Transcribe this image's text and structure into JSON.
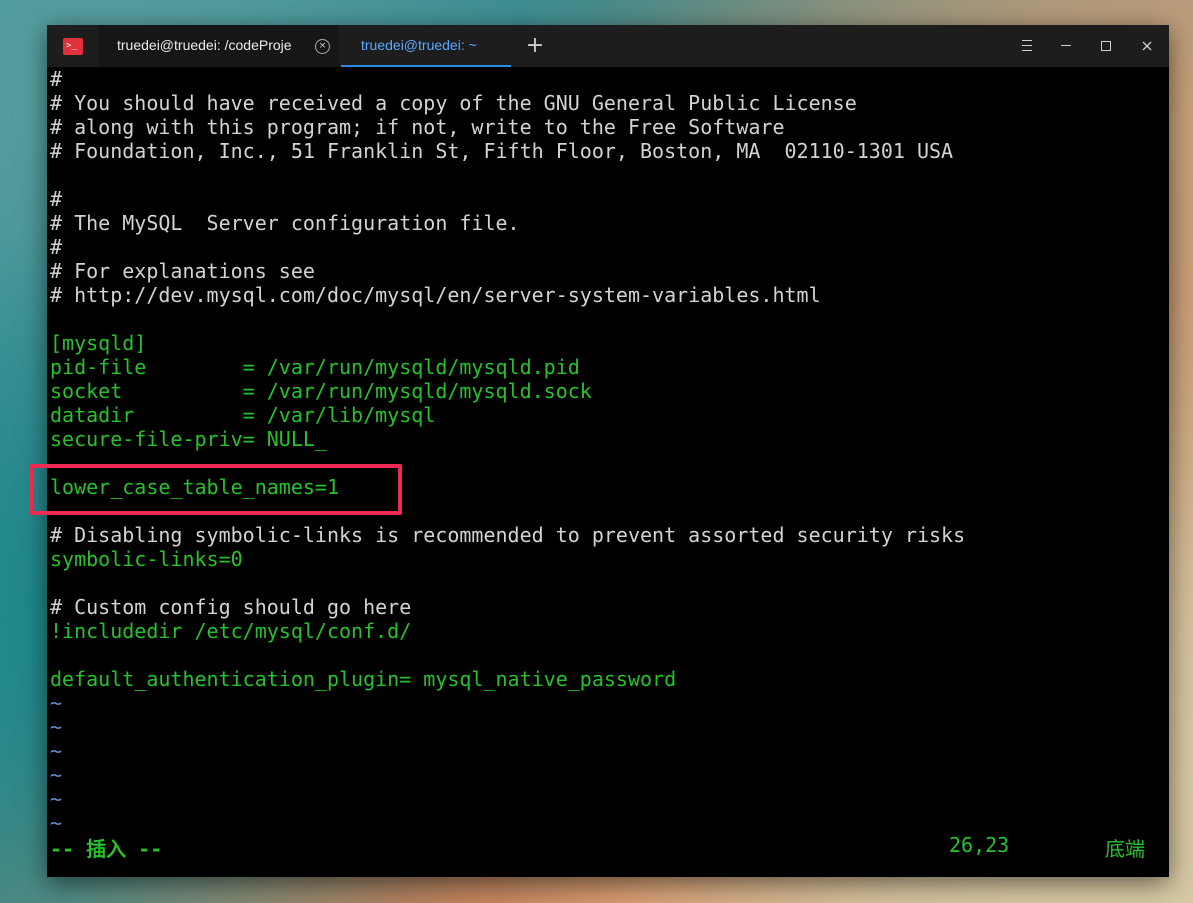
{
  "tabs": [
    {
      "label": "truedei@truedei: /codeProje",
      "close_icon": "×"
    },
    {
      "label": "truedei@truedei: ~"
    }
  ],
  "controls": {
    "new_tab_icon": "+"
  },
  "lines": [
    "#",
    "# You should have received a copy of the GNU General Public License",
    "# along with this program; if not, write to the Free Software",
    "# Foundation, Inc., 51 Franklin St, Fifth Floor, Boston, MA  02110-1301 USA",
    "",
    "#",
    "# The MySQL  Server configuration file.",
    "#",
    "# For explanations see",
    "# http://dev.mysql.com/doc/mysql/en/server-system-variables.html",
    "",
    "[mysqld]",
    "pid-file        = /var/run/mysqld/mysqld.pid",
    "socket          = /var/run/mysqld/mysqld.sock",
    "datadir         = /var/lib/mysql",
    "secure-file-priv= NULL_",
    "",
    "lower_case_table_names=1",
    "",
    "# Disabling symbolic-links is recommended to prevent assorted security risks",
    "symbolic-links=0",
    "",
    "# Custom config should go here",
    "!includedir /etc/mysql/conf.d/",
    "",
    "default_authentication_plugin= mysql_native_password",
    "~",
    "~",
    "~",
    "~",
    "~",
    "~"
  ],
  "status": {
    "mode": "-- 插入 --",
    "position": "26,23",
    "scroll": "底端"
  },
  "colors": {
    "terminal_bg": "#000000",
    "comment_text": "#d3d3d3",
    "config_text": "#27c12c",
    "tilde": "#5f8dd3",
    "highlight_border": "#ee2a52",
    "active_tab": "#5aa8ff"
  }
}
